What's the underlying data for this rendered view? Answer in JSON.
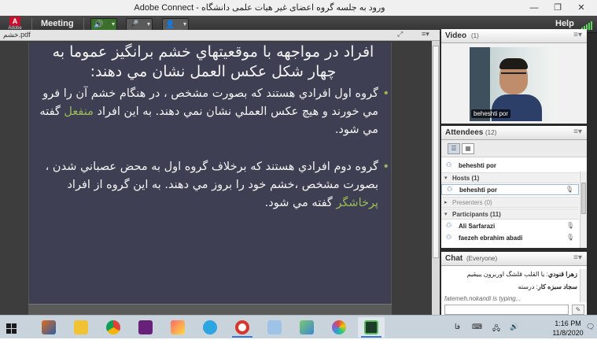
{
  "window": {
    "title": "ورود به جلسه  گروه اعضای غیر هیات علمی دانشگاه - Adobe Connect",
    "minimize": "—",
    "maximize": "❐",
    "close": "✕"
  },
  "menubar": {
    "logo_mark": "A",
    "logo_text": "Adobe",
    "meeting": "Meeting",
    "help": "Help",
    "speaker_icon": "🔊",
    "mic_icon": "🎤",
    "webcam_icon": "👤",
    "dropdown": "▾"
  },
  "share": {
    "filename": "خشم.pdf",
    "fullscreen_icon": "⤢",
    "menu_icon": "≡▾",
    "slide": {
      "heading": "افراد در مواجهه با موقعيتهاي خشم برانگيز عموما به چهار شكل عكس العمل نشان مي دهند:",
      "bullets": [
        {
          "dot": "•",
          "before": "گروه اول افرادي هستند كه بصورت مشخص ، در هنگام خشم آن را فرو مي خورند و هيچ عكس العملي نشان      نمي دهند. به اين افراد ",
          "highlight": "منفعل",
          "after": " گفته مي شود."
        },
        {
          "dot": "•",
          "before": "گروه دوم افرادي هستند كه برخلاف گروه اول به محض عصباني شدن ، بصورت مشخص ،خشم خود را بروز        مي دهند. به اين گروه از افراد ",
          "highlight": "پرخاشگر",
          "after": " گفته مي شود."
        }
      ]
    }
  },
  "video_pod": {
    "title": "Video",
    "count": "(1)",
    "menu_icon": "≡▾",
    "label": "beheshti por"
  },
  "attendees_pod": {
    "title": "Attendees",
    "count": "(12)",
    "menu_icon": "≡▾",
    "view_list": "☰",
    "view_grid": "▦",
    "me": "beheshti por",
    "groups": {
      "hosts": "Hosts (1)",
      "presenters": "Presenters (0)",
      "participants": "Participants (11)"
    },
    "hosts": [
      "beheshti por"
    ],
    "participants": [
      "Ali Sarfarazi",
      "faezeh ebrahim abadi"
    ]
  },
  "chat_pod": {
    "title": "Chat",
    "scope": "(Everyone)",
    "menu_icon": "≡▾",
    "messages": [
      {
        "author": "زهرا قنودي",
        "text": "يا القلب قلشگ اوربرون يبيقيم"
      },
      {
        "author": "سجاد سبزه كار",
        "text": "درسته"
      }
    ],
    "typing": "fatemeh.nokandi is typing...",
    "send_icon": "✎"
  },
  "taskbar": {
    "apps": [
      "matlab",
      "file-explorer",
      "chrome",
      "visual-studio",
      "paint",
      "telegram",
      "recorder",
      "notepad",
      "photos",
      "color-palette",
      "adobe-connect"
    ],
    "time": "1:16 PM",
    "date": "11/8/2020",
    "lang": "فا",
    "keyboard_icon": "⌨",
    "network_icon": "🖧",
    "volume_icon": "🔊",
    "notification_icon": "🗨"
  }
}
